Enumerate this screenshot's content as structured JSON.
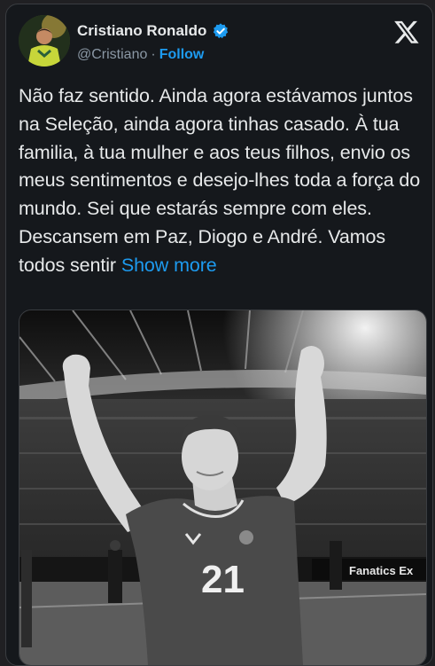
{
  "author": {
    "display_name": "Cristiano Ronaldo",
    "handle": "@Cristiano",
    "separator": "·",
    "follow_label": "Follow",
    "verified": true
  },
  "tweet": {
    "text": "Não faz sentido. Ainda agora estávamos juntos na Seleção, ainda agora tinhas casado. À tua familia, à tua mulher e aos teus filhos, envio os meus sentimentos e desejo-lhes toda a força do mundo. Sei que estarás sempre com eles. Descansem em Paz, Diogo e André. Vamos todos sentir",
    "show_more_label": "Show more"
  },
  "media": {
    "jersey_number": "21",
    "board_text": "Fanatics Ex"
  },
  "colors": {
    "accent": "#1d9bf0",
    "background": "#15181c",
    "secondary_text": "#8b98a5"
  },
  "icons": {
    "brand": "x-logo-icon",
    "verified": "verified-badge-icon"
  }
}
